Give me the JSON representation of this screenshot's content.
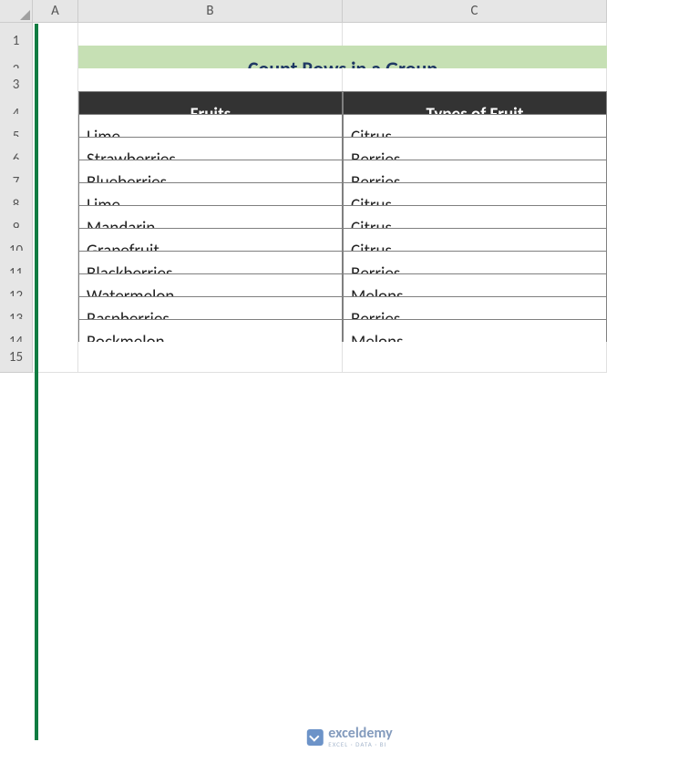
{
  "columns": [
    "A",
    "B",
    "C"
  ],
  "row_numbers": [
    "1",
    "2",
    "3",
    "4",
    "5",
    "6",
    "7",
    "8",
    "9",
    "10",
    "11",
    "12",
    "13",
    "14",
    "15"
  ],
  "title": "Count Rows in a Group",
  "table": {
    "headers": [
      "Fruits",
      "Types of Fruit"
    ],
    "rows": [
      {
        "fruit": "Lime",
        "type": "Citrus"
      },
      {
        "fruit": "Strawberries",
        "type": "Berries"
      },
      {
        "fruit": "Blueberries",
        "type": "Berries"
      },
      {
        "fruit": "Lime",
        "type": "Citrus"
      },
      {
        "fruit": "Mandarin",
        "type": "Citrus"
      },
      {
        "fruit": "Grapefruit",
        "type": "Citrus"
      },
      {
        "fruit": "Blackberries",
        "type": "Berries"
      },
      {
        "fruit": "Watermelon",
        "type": "Melons"
      },
      {
        "fruit": "Raspberries",
        "type": "Berries"
      },
      {
        "fruit": "Rockmelon",
        "type": "Melons"
      }
    ]
  },
  "watermark": {
    "main": "exceldemy",
    "sub": "EXCEL · DATA · BI"
  }
}
